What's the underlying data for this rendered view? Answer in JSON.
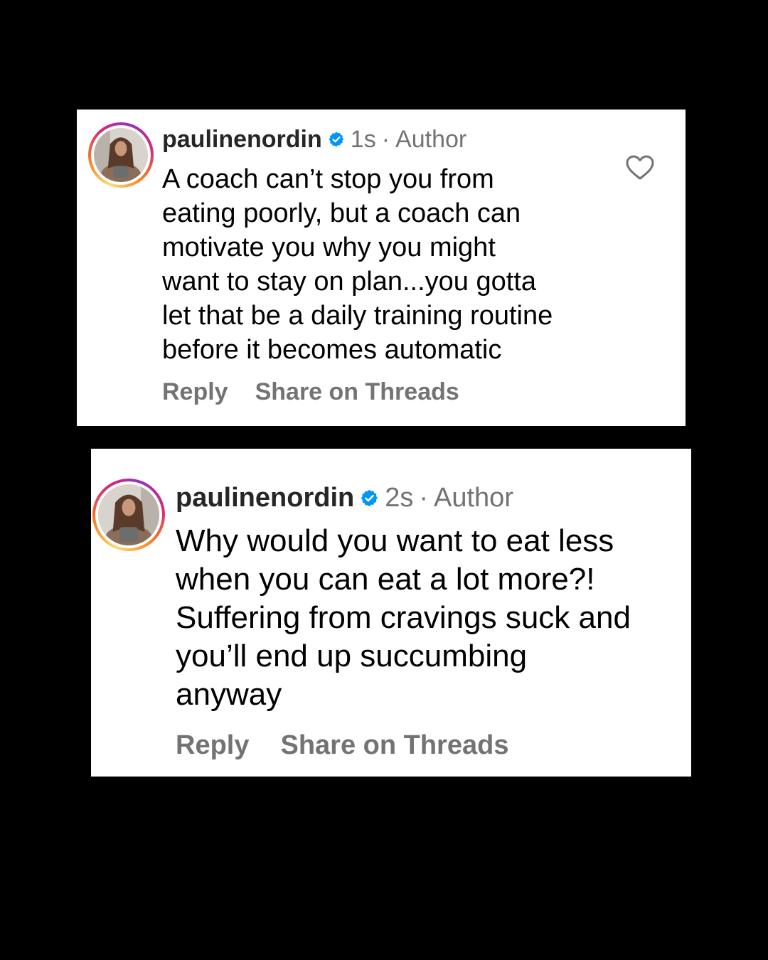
{
  "comments": [
    {
      "username": "paulinenordin",
      "time": "1s",
      "separator": "·",
      "role": "Author",
      "text": "A coach can’t stop you from\neating poorly, but a coach can\nmotivate you why you might\nwant to stay on plan...you gotta\nlet that be a daily training routine\nbefore it becomes automatic",
      "reply_label": "Reply",
      "share_label": "Share on Threads",
      "like_icon": "heart-outline-icon"
    },
    {
      "username": "paulinenordin",
      "time": "2s",
      "separator": "·",
      "role": "Author",
      "text": "Why would you want to eat less\nwhen you can eat  a lot more?!\nSuffering from cravings suck and\nyou’ll end up succumbing\nanyway",
      "reply_label": "Reply",
      "share_label": "Share on Threads"
    }
  ],
  "colors": {
    "background": "#000000",
    "card": "#ffffff",
    "text": "#000000",
    "muted": "#737373",
    "verified": "#0095f6"
  }
}
